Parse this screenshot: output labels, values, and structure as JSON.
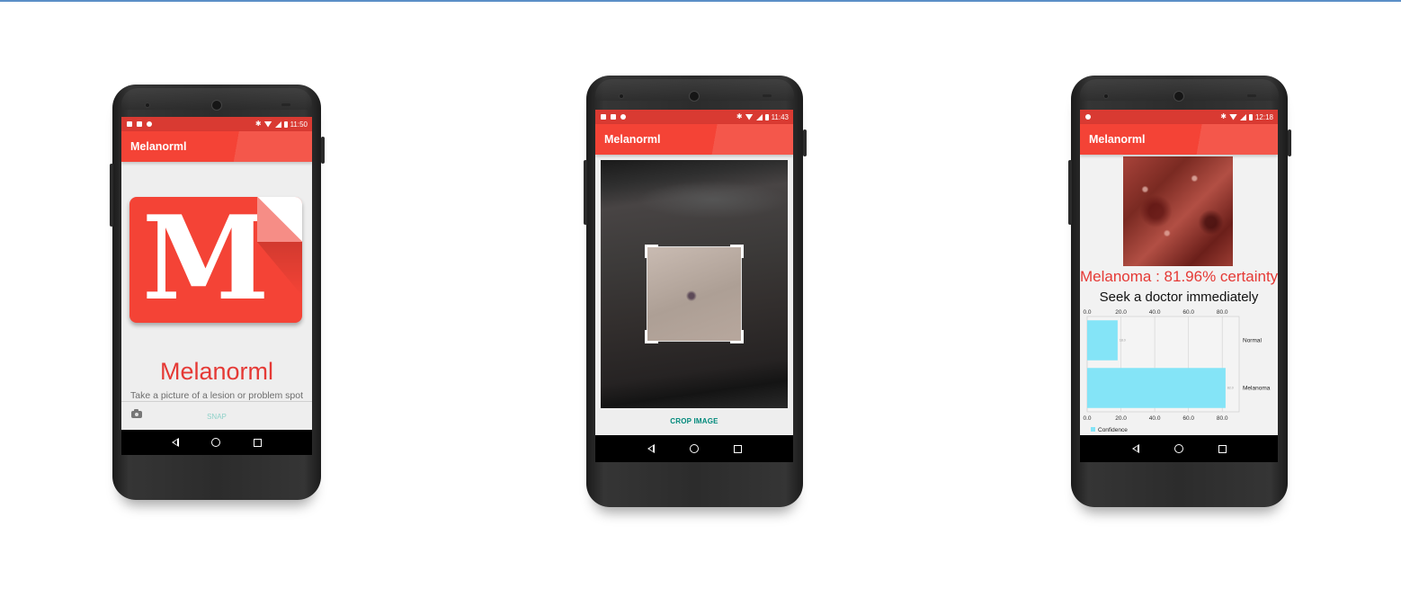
{
  "app": {
    "name": "Melanorml"
  },
  "phone1": {
    "status": {
      "time": "11:50"
    },
    "appbar_title": "Melanorml",
    "logo_letter": "M",
    "title": "Melanorml",
    "subtitle": "Take a picture of a lesion or problem spot",
    "snap_label": "SNAP",
    "colors": {
      "primary": "#f44336",
      "snap": "#8fd1c9"
    }
  },
  "phone2": {
    "status": {
      "time": "11:43"
    },
    "appbar_title": "Melanorml",
    "crop_label": "CROP IMAGE",
    "colors": {
      "crop": "#00897b"
    }
  },
  "phone3": {
    "status": {
      "time": "12:18"
    },
    "appbar_title": "Melanorml",
    "verdict": "Melanoma : 81.96% certainty",
    "advice": "Seek a doctor immediately",
    "chart_data": {
      "type": "bar",
      "orientation": "horizontal",
      "categories": [
        "Normal",
        "Melanoma"
      ],
      "series": [
        {
          "name": "Confidence",
          "values": [
            18.04,
            81.96
          ],
          "color": "#84e4f7"
        }
      ],
      "tick_labels": [
        "0.0",
        "20.0",
        "40.0",
        "60.0",
        "80.0"
      ],
      "xlim": [
        0,
        90
      ],
      "grid": true,
      "legend": "bottom-left"
    }
  }
}
